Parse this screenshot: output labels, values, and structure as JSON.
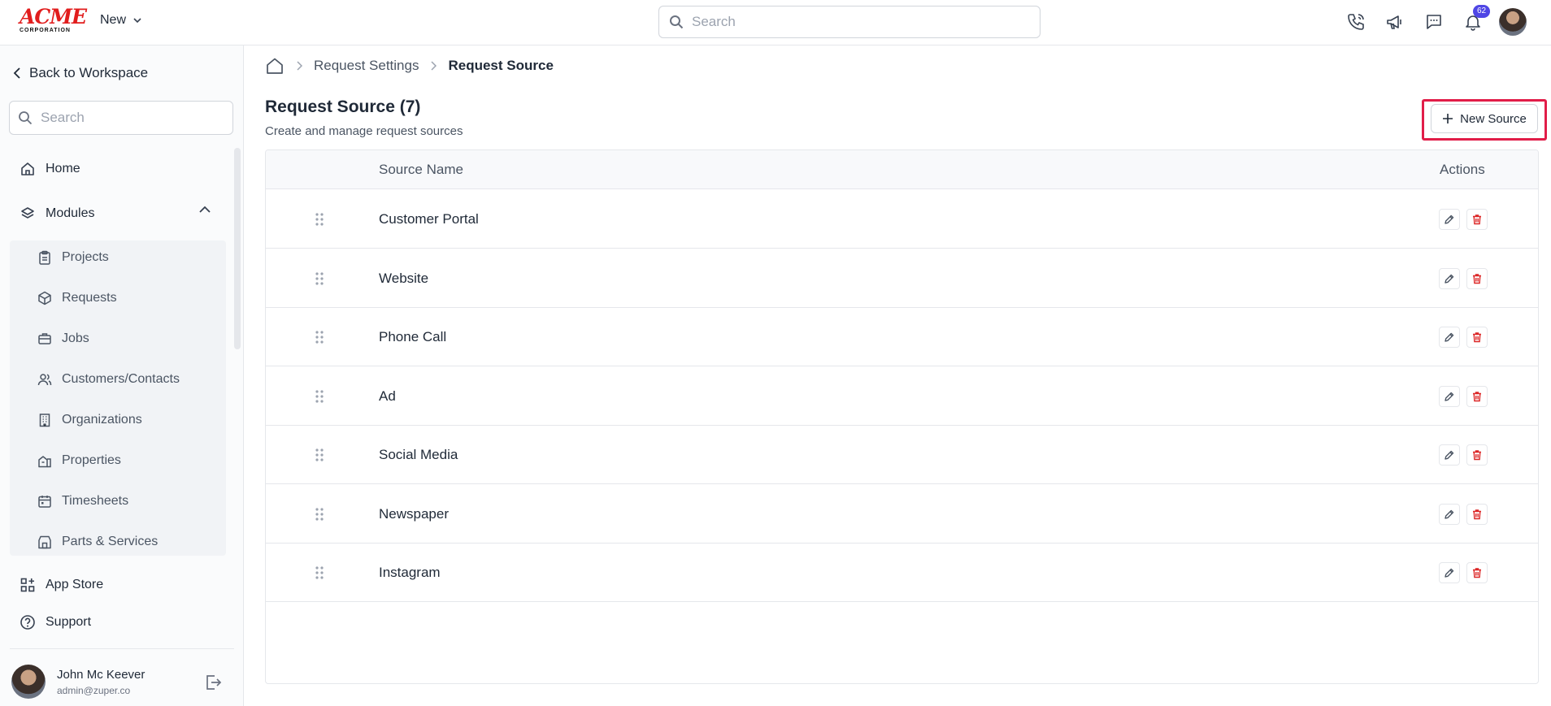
{
  "topbar": {
    "logo_text": "ACME",
    "logo_sub": "CORPORATION",
    "new_label": "New",
    "search_placeholder": "Search",
    "notification_count": "62"
  },
  "sidebar": {
    "back_label": "Back to Workspace",
    "search_placeholder": "Search",
    "home_label": "Home",
    "modules_label": "Modules",
    "submenu": [
      {
        "label": "Projects",
        "icon": "clipboard-icon"
      },
      {
        "label": "Requests",
        "icon": "box-icon"
      },
      {
        "label": "Jobs",
        "icon": "briefcase-icon"
      },
      {
        "label": "Customers/Contacts",
        "icon": "users-icon"
      },
      {
        "label": "Organizations",
        "icon": "building-icon"
      },
      {
        "label": "Properties",
        "icon": "property-icon"
      },
      {
        "label": "Timesheets",
        "icon": "calendar-icon"
      },
      {
        "label": "Parts & Services",
        "icon": "store-icon"
      }
    ],
    "app_store_label": "App Store",
    "support_label": "Support",
    "user": {
      "name": "John Mc Keever",
      "email": "admin@zuper.co"
    }
  },
  "breadcrumb": {
    "items": [
      "Request Settings",
      "Request Source"
    ]
  },
  "page": {
    "title": "Request Source (7)",
    "subtitle": "Create and manage request sources",
    "new_button_label": "New Source"
  },
  "table": {
    "headers": {
      "name": "Source Name",
      "actions": "Actions"
    },
    "rows": [
      "Customer Portal",
      "Website",
      "Phone Call",
      "Ad",
      "Social Media",
      "Newspaper",
      "Instagram"
    ]
  },
  "colors": {
    "accent": "#4f46e5",
    "danger": "#dc2626",
    "highlight": "#e11d48",
    "brand": "#e11d1d"
  }
}
